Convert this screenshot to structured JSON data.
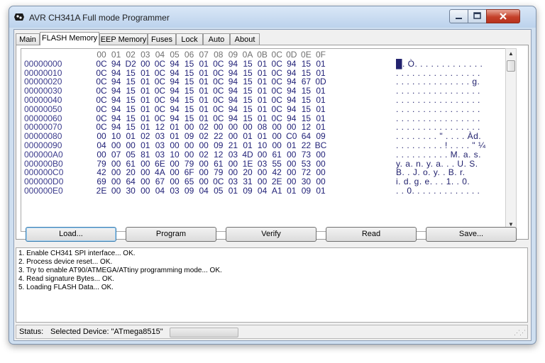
{
  "window": {
    "title": "AVR CH341A Full mode Programmer"
  },
  "tabs": [
    {
      "label": "Main"
    },
    {
      "label": "FLASH Memory"
    },
    {
      "label": "EEP Memory"
    },
    {
      "label": "Fuses"
    },
    {
      "label": "Lock"
    },
    {
      "label": "Auto"
    },
    {
      "label": "About"
    }
  ],
  "hex": {
    "header": [
      "00",
      "01",
      "02",
      "03",
      "04",
      "05",
      "06",
      "07",
      "08",
      "09",
      "0A",
      "0B",
      "0C",
      "0D",
      "0E",
      "0F"
    ],
    "rows": [
      {
        "addr": "00000000",
        "bytes": [
          "0C",
          "94",
          "D2",
          "00",
          "0C",
          "94",
          "15",
          "01",
          "0C",
          "94",
          "15",
          "01",
          "0C",
          "94",
          "15",
          "01"
        ],
        "ascii": "█. Ò. . . . . . . . . . . . ."
      },
      {
        "addr": "00000010",
        "bytes": [
          "0C",
          "94",
          "15",
          "01",
          "0C",
          "94",
          "15",
          "01",
          "0C",
          "94",
          "15",
          "01",
          "0C",
          "94",
          "15",
          "01"
        ],
        "ascii": ". . . . . . . . . . . . . . . ."
      },
      {
        "addr": "00000020",
        "bytes": [
          "0C",
          "94",
          "15",
          "01",
          "0C",
          "94",
          "15",
          "01",
          "0C",
          "94",
          "15",
          "01",
          "0C",
          "94",
          "67",
          "0D"
        ],
        "ascii": ". . . . . . . . . . . . . . g."
      },
      {
        "addr": "00000030",
        "bytes": [
          "0C",
          "94",
          "15",
          "01",
          "0C",
          "94",
          "15",
          "01",
          "0C",
          "94",
          "15",
          "01",
          "0C",
          "94",
          "15",
          "01"
        ],
        "ascii": ". . . . . . . . . . . . . . . ."
      },
      {
        "addr": "00000040",
        "bytes": [
          "0C",
          "94",
          "15",
          "01",
          "0C",
          "94",
          "15",
          "01",
          "0C",
          "94",
          "15",
          "01",
          "0C",
          "94",
          "15",
          "01"
        ],
        "ascii": ". . . . . . . . . . . . . . . ."
      },
      {
        "addr": "00000050",
        "bytes": [
          "0C",
          "94",
          "15",
          "01",
          "0C",
          "94",
          "15",
          "01",
          "0C",
          "94",
          "15",
          "01",
          "0C",
          "94",
          "15",
          "01"
        ],
        "ascii": ". . . . . . . . . . . . . . . ."
      },
      {
        "addr": "00000060",
        "bytes": [
          "0C",
          "94",
          "15",
          "01",
          "0C",
          "94",
          "15",
          "01",
          "0C",
          "94",
          "15",
          "01",
          "0C",
          "94",
          "15",
          "01"
        ],
        "ascii": ". . . . . . . . . . . . . . . ."
      },
      {
        "addr": "00000070",
        "bytes": [
          "0C",
          "94",
          "15",
          "01",
          "12",
          "01",
          "00",
          "02",
          "00",
          "00",
          "00",
          "08",
          "00",
          "00",
          "12",
          "01"
        ],
        "ascii": ". . . . . . . . . . . . . . . ."
      },
      {
        "addr": "00000080",
        "bytes": [
          "00",
          "10",
          "01",
          "02",
          "03",
          "01",
          "09",
          "02",
          "22",
          "00",
          "01",
          "01",
          "00",
          "C0",
          "64",
          "09"
        ],
        "ascii": ". . . . . . . . \" . . . . Àd."
      },
      {
        "addr": "00000090",
        "bytes": [
          "04",
          "00",
          "00",
          "01",
          "03",
          "00",
          "00",
          "00",
          "09",
          "21",
          "01",
          "10",
          "00",
          "01",
          "22",
          "BC"
        ],
        "ascii": ". . . . . . . . . ! . . . . \" ¼"
      },
      {
        "addr": "000000A0",
        "bytes": [
          "00",
          "07",
          "05",
          "81",
          "03",
          "10",
          "00",
          "02",
          "12",
          "03",
          "4D",
          "00",
          "61",
          "00",
          "73",
          "00"
        ],
        "ascii": ". . . . . . . . . . M. a. s."
      },
      {
        "addr": "000000B0",
        "bytes": [
          "79",
          "00",
          "61",
          "00",
          "6E",
          "00",
          "79",
          "00",
          "61",
          "00",
          "1E",
          "03",
          "55",
          "00",
          "53",
          "00"
        ],
        "ascii": "y. a. n. y. a. . . U. S."
      },
      {
        "addr": "000000C0",
        "bytes": [
          "42",
          "00",
          "20",
          "00",
          "4A",
          "00",
          "6F",
          "00",
          "79",
          "00",
          "20",
          "00",
          "42",
          "00",
          "72",
          "00"
        ],
        "ascii": "B. . J. o. y. . B. r."
      },
      {
        "addr": "000000D0",
        "bytes": [
          "69",
          "00",
          "64",
          "00",
          "67",
          "00",
          "65",
          "00",
          "0C",
          "03",
          "31",
          "00",
          "2E",
          "00",
          "30",
          "00"
        ],
        "ascii": "i. d. g. e. . . 1. . 0."
      },
      {
        "addr": "000000E0",
        "bytes": [
          "2E",
          "00",
          "30",
          "00",
          "04",
          "03",
          "09",
          "04",
          "05",
          "01",
          "09",
          "04",
          "A1",
          "01",
          "09",
          "01"
        ],
        "ascii": ". . 0. . . . . . . . . . . . ."
      }
    ]
  },
  "buttons": {
    "load": "Load...",
    "program": "Program",
    "verify": "Verify",
    "read": "Read",
    "save": "Save..."
  },
  "log": [
    "1. Enable CH341 SPI interface... OK.",
    "2. Process device reset... OK.",
    "3. Try to enable AT90/ATMEGA/ATtiny programming mode... OK.",
    "4. Read signature Bytes... OK.",
    "5. Loading FLASH Data... OK."
  ],
  "status": {
    "label": "Status:",
    "value": "Selected Device: \"ATmega8515\"",
    "progress": 0
  },
  "colors": {
    "hex_value": "#222278",
    "address": "#3b3b8c",
    "close_button": "#c4412a"
  }
}
